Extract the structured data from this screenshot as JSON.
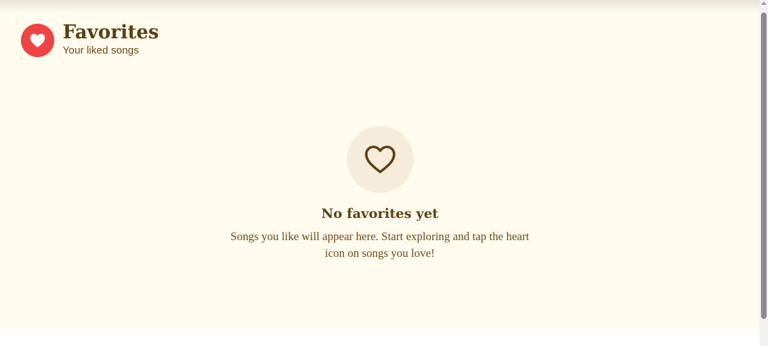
{
  "header": {
    "title": "Favorites",
    "subtitle": "Your liked songs",
    "icon": "heart-icon"
  },
  "empty_state": {
    "icon": "heart-outline-icon",
    "title": "No favorites yet",
    "description": "Songs you like will appear here. Start exploring and tap the heart icon on songs you love!"
  },
  "colors": {
    "background": "#fffbee",
    "accent": "#ef4444",
    "text": "#5c3f12",
    "icon_circle": "#f6ecdc"
  }
}
